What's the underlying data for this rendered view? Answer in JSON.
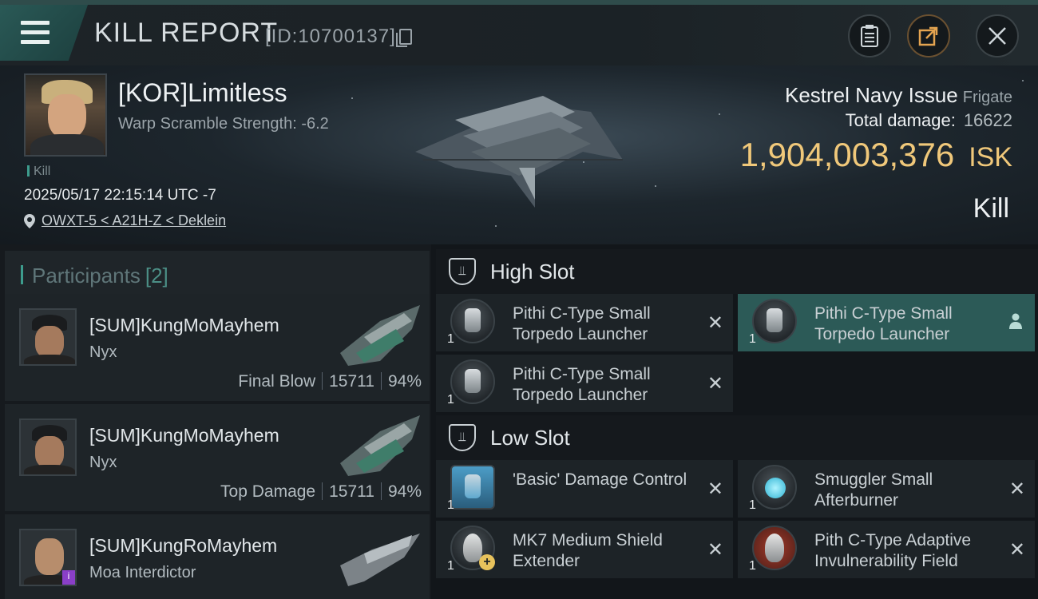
{
  "header": {
    "title": "KILL REPORT",
    "report_id": "[ID:10700137]"
  },
  "victim": {
    "name": "[KOR]Limitless",
    "warp_scramble": "Warp Scramble Strength: -6.2",
    "tag": "Kill",
    "datetime": "2025/05/17 22:15:14 UTC -7",
    "location": "OWXT-5 < A21H-Z < Deklein",
    "ship_name": "Kestrel Navy Issue",
    "ship_class": "Frigate",
    "total_damage_label": "Total damage:",
    "total_damage": "16622",
    "isk_value": "1,904,003,376",
    "isk_unit": "ISK",
    "result": "Kill"
  },
  "participants": {
    "label": "Participants",
    "count": "[2]",
    "items": [
      {
        "name": "[SUM]KungMoMayhem",
        "ship": "Nyx",
        "role": "Final Blow",
        "damage": "15711",
        "percent": "94%"
      },
      {
        "name": "[SUM]KungMoMayhem",
        "ship": "Nyx",
        "role": "Top Damage",
        "damage": "15711",
        "percent": "94%"
      },
      {
        "name": "[SUM]KungRoMayhem",
        "ship": "Moa Interdictor",
        "role": "",
        "damage": "",
        "percent": ""
      }
    ]
  },
  "slots": {
    "high": {
      "label": "High Slot",
      "modules": [
        {
          "qty": "1",
          "name": "Pithi C-Type Small Torpedo Launcher",
          "state": "destroyed"
        },
        {
          "qty": "1",
          "name": "Pithi C-Type Small Torpedo Launcher",
          "state": "dropped",
          "icon": "person-icon"
        },
        {
          "qty": "1",
          "name": "Pithi C-Type Small Torpedo Launcher",
          "state": "destroyed"
        }
      ]
    },
    "low": {
      "label": "Low Slot",
      "modules": [
        {
          "qty": "1",
          "name": "'Basic' Damage Control",
          "state": "destroyed"
        },
        {
          "qty": "1",
          "name": "Smuggler Small Afterburner",
          "state": "destroyed"
        },
        {
          "qty": "1",
          "name": "MK7 Medium Shield Extender",
          "state": "destroyed"
        },
        {
          "qty": "1",
          "name": "Pith C-Type Adaptive Invulnerability Field",
          "state": "destroyed"
        }
      ]
    }
  },
  "colors": {
    "accent": "#2f5f5b",
    "isk": "#f0c87a",
    "highlight_row": "#2c5a57"
  }
}
